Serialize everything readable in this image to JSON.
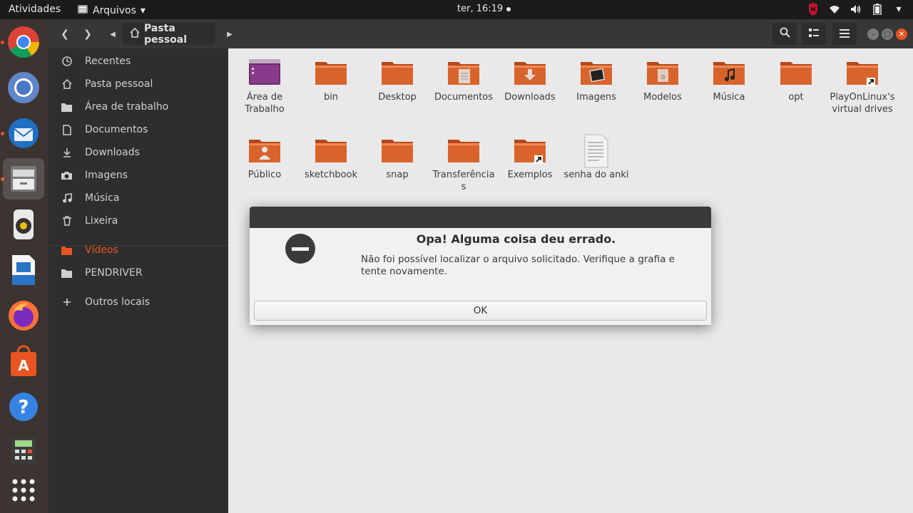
{
  "topbar": {
    "activities": "Atividades",
    "app_menu": "Arquivos",
    "clock": "ter, 16:19",
    "tray_icons": [
      "mcafee-icon",
      "wifi-icon",
      "volume-icon",
      "battery-icon",
      "system-menu-chevron-icon"
    ]
  },
  "dock": {
    "items": [
      {
        "name": "google-chrome",
        "running": true
      },
      {
        "name": "chromium",
        "running": false
      },
      {
        "name": "thunderbird",
        "running": true
      },
      {
        "name": "files",
        "running": true,
        "active": true
      },
      {
        "name": "rhythmbox",
        "running": false
      },
      {
        "name": "libreoffice-writer",
        "running": false
      },
      {
        "name": "firefox",
        "running": false
      },
      {
        "name": "ubuntu-software",
        "running": false
      },
      {
        "name": "help",
        "running": false
      },
      {
        "name": "calculator",
        "running": false
      },
      {
        "name": "show-applications",
        "running": false
      }
    ]
  },
  "headerbar": {
    "path_label": "Pasta pessoal"
  },
  "sidebar": {
    "items": [
      {
        "label": "Recentes",
        "icon": "clock-icon"
      },
      {
        "label": "Pasta pessoal",
        "icon": "home-icon"
      },
      {
        "label": "Área de trabalho",
        "icon": "folder-icon"
      },
      {
        "label": "Documentos",
        "icon": "document-icon"
      },
      {
        "label": "Downloads",
        "icon": "download-icon"
      },
      {
        "label": "Imagens",
        "icon": "camera-icon"
      },
      {
        "label": "Música",
        "icon": "music-icon"
      },
      {
        "label": "Lixeira",
        "icon": "trash-icon"
      },
      {
        "label": "Vídeos",
        "icon": "folder-icon",
        "selected": true
      },
      {
        "label": "PENDRIVER",
        "icon": "folder-icon"
      },
      {
        "label": "Outros locais",
        "icon": "plus-icon"
      }
    ]
  },
  "files": [
    {
      "label": "Área de Trabalho",
      "type": "desktop-folder"
    },
    {
      "label": "bin",
      "type": "folder"
    },
    {
      "label": "Desktop",
      "type": "folder"
    },
    {
      "label": "Documentos",
      "type": "documents-folder"
    },
    {
      "label": "Downloads",
      "type": "downloads-folder"
    },
    {
      "label": "Imagens",
      "type": "pictures-folder"
    },
    {
      "label": "Modelos",
      "type": "templates-folder"
    },
    {
      "label": "Música",
      "type": "music-folder"
    },
    {
      "label": "opt",
      "type": "folder"
    },
    {
      "label": "PlayOnLinux's virtual drives",
      "type": "link-folder"
    },
    {
      "label": "Público",
      "type": "public-folder"
    },
    {
      "label": "sketchbook",
      "type": "folder"
    },
    {
      "label": "snap",
      "type": "folder"
    },
    {
      "label": "Transferências",
      "type": "folder"
    },
    {
      "label": "Exemplos",
      "type": "link-folder"
    },
    {
      "label": "senha do anki",
      "type": "text-file"
    }
  ],
  "dialog": {
    "title": "Opa! Alguma coisa deu errado.",
    "message": "Não foi possível localizar o arquivo solicitado. Verifique a grafia e tente novamente.",
    "ok_label": "OK"
  },
  "colors": {
    "accent": "#e95420",
    "folder": "#d8642c",
    "dock_bg": "#3b3431"
  }
}
